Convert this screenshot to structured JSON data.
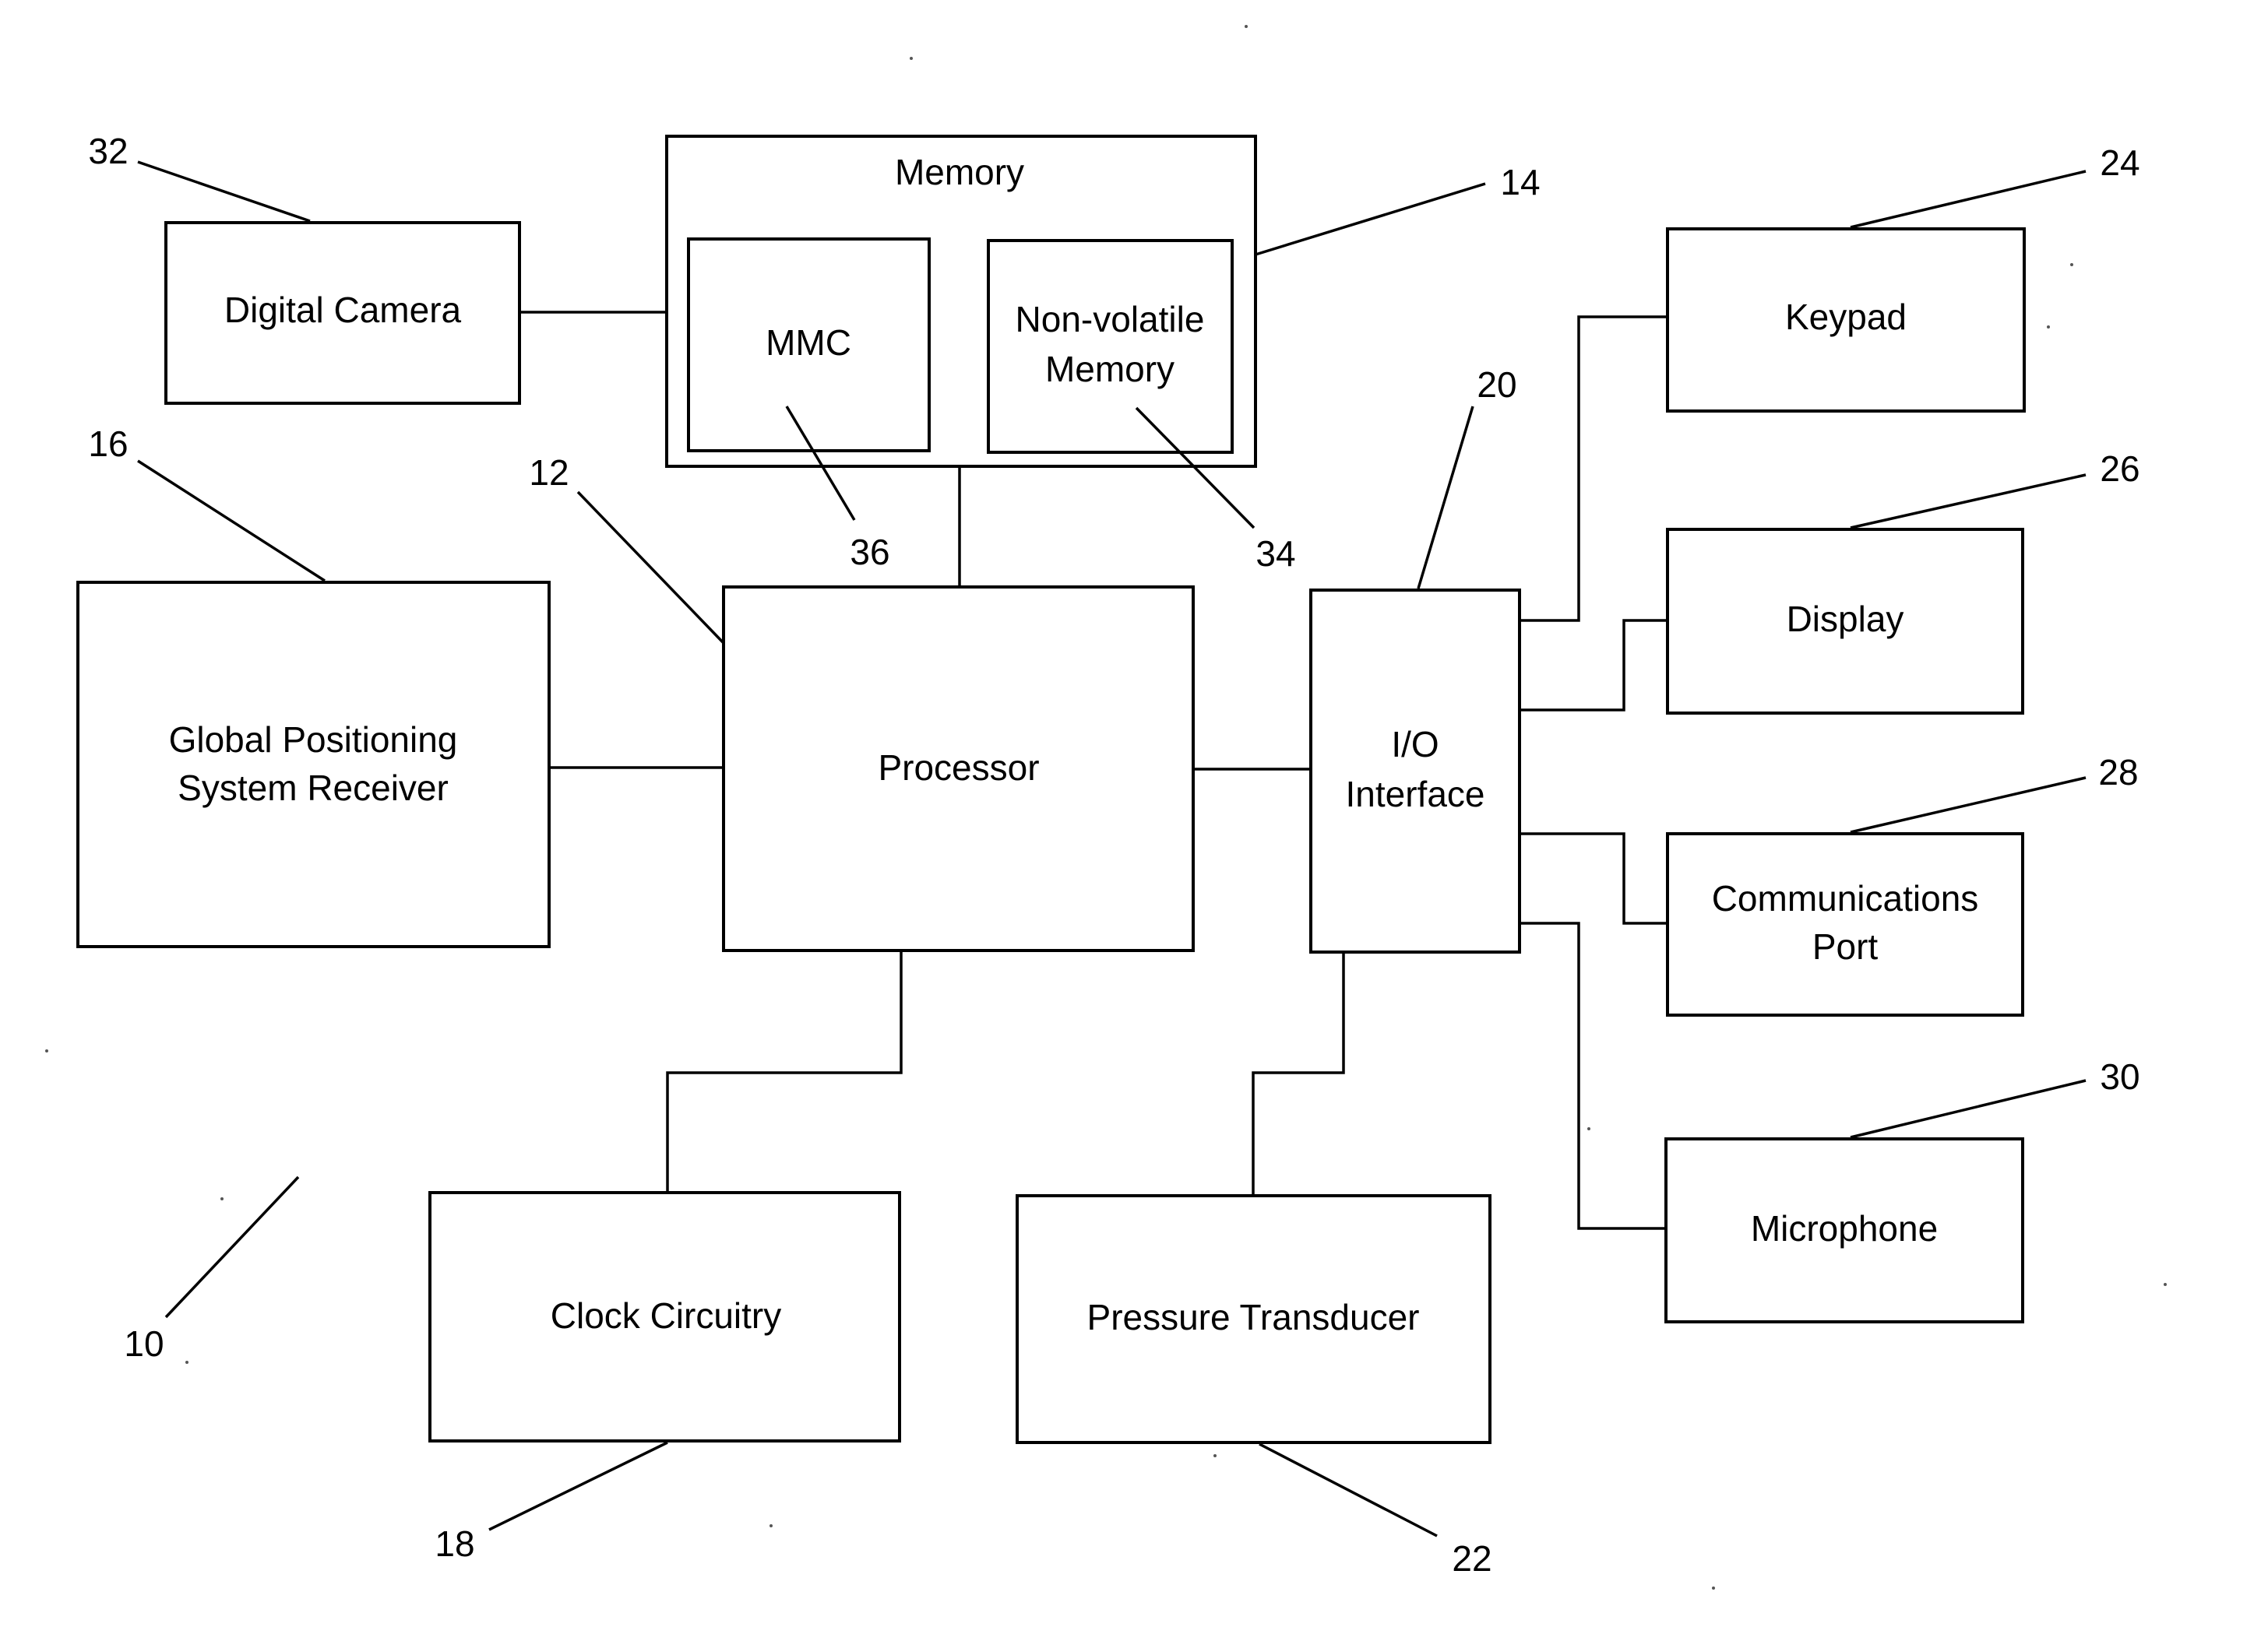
{
  "figure": {
    "system_ref": "10",
    "blocks": {
      "digital_camera": {
        "label": [
          "Digital Camera"
        ],
        "ref": "32"
      },
      "memory": {
        "label": [
          "Memory"
        ],
        "ref": "14"
      },
      "mmc": {
        "label": [
          "MMC"
        ],
        "ref": "36"
      },
      "non_volatile_memory": {
        "label": [
          "Non-volatile",
          "Memory"
        ],
        "ref": "34"
      },
      "gps_receiver": {
        "label": [
          "Global Positioning",
          "System Receiver"
        ],
        "ref": "16"
      },
      "processor": {
        "label": [
          "Processor"
        ],
        "ref": "12"
      },
      "io_interface": {
        "label": [
          "I/O",
          "Interface"
        ],
        "ref": "20"
      },
      "keypad": {
        "label": [
          "Keypad"
        ],
        "ref": "24"
      },
      "display": {
        "label": [
          "Display"
        ],
        "ref": "26"
      },
      "communications_port": {
        "label": [
          "Communications",
          "Port"
        ],
        "ref": "28"
      },
      "microphone": {
        "label": [
          "Microphone"
        ],
        "ref": "30"
      },
      "clock_circuitry": {
        "label": [
          "Clock Circuitry"
        ],
        "ref": "18"
      },
      "pressure_transducer": {
        "label": [
          "Pressure Transducer"
        ],
        "ref": "22"
      }
    },
    "connections": [
      [
        "digital_camera",
        "memory"
      ],
      [
        "memory",
        "processor"
      ],
      [
        "gps_receiver",
        "processor"
      ],
      [
        "processor",
        "io_interface"
      ],
      [
        "processor",
        "clock_circuitry"
      ],
      [
        "io_interface",
        "keypad"
      ],
      [
        "io_interface",
        "display"
      ],
      [
        "io_interface",
        "communications_port"
      ],
      [
        "io_interface",
        "microphone"
      ],
      [
        "io_interface",
        "pressure_transducer"
      ]
    ]
  }
}
